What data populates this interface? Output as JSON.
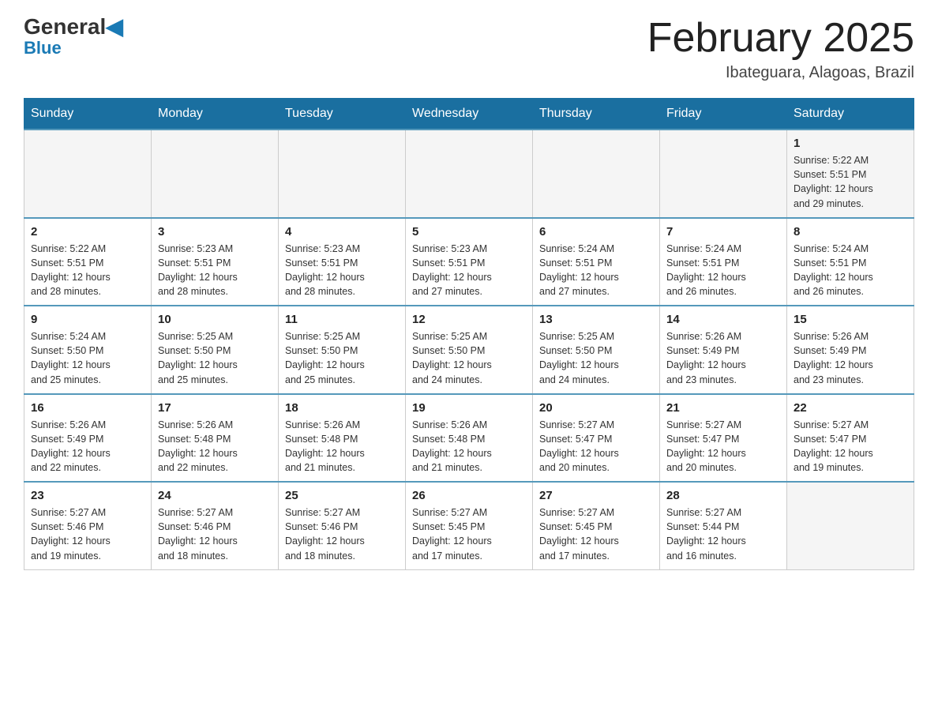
{
  "header": {
    "logo_general": "General",
    "logo_blue": "Blue",
    "month_title": "February 2025",
    "location": "Ibateguara, Alagoas, Brazil"
  },
  "weekdays": [
    "Sunday",
    "Monday",
    "Tuesday",
    "Wednesday",
    "Thursday",
    "Friday",
    "Saturday"
  ],
  "weeks": [
    {
      "days": [
        {
          "num": "",
          "info": ""
        },
        {
          "num": "",
          "info": ""
        },
        {
          "num": "",
          "info": ""
        },
        {
          "num": "",
          "info": ""
        },
        {
          "num": "",
          "info": ""
        },
        {
          "num": "",
          "info": ""
        },
        {
          "num": "1",
          "info": "Sunrise: 5:22 AM\nSunset: 5:51 PM\nDaylight: 12 hours\nand 29 minutes."
        }
      ]
    },
    {
      "days": [
        {
          "num": "2",
          "info": "Sunrise: 5:22 AM\nSunset: 5:51 PM\nDaylight: 12 hours\nand 28 minutes."
        },
        {
          "num": "3",
          "info": "Sunrise: 5:23 AM\nSunset: 5:51 PM\nDaylight: 12 hours\nand 28 minutes."
        },
        {
          "num": "4",
          "info": "Sunrise: 5:23 AM\nSunset: 5:51 PM\nDaylight: 12 hours\nand 28 minutes."
        },
        {
          "num": "5",
          "info": "Sunrise: 5:23 AM\nSunset: 5:51 PM\nDaylight: 12 hours\nand 27 minutes."
        },
        {
          "num": "6",
          "info": "Sunrise: 5:24 AM\nSunset: 5:51 PM\nDaylight: 12 hours\nand 27 minutes."
        },
        {
          "num": "7",
          "info": "Sunrise: 5:24 AM\nSunset: 5:51 PM\nDaylight: 12 hours\nand 26 minutes."
        },
        {
          "num": "8",
          "info": "Sunrise: 5:24 AM\nSunset: 5:51 PM\nDaylight: 12 hours\nand 26 minutes."
        }
      ]
    },
    {
      "days": [
        {
          "num": "9",
          "info": "Sunrise: 5:24 AM\nSunset: 5:50 PM\nDaylight: 12 hours\nand 25 minutes."
        },
        {
          "num": "10",
          "info": "Sunrise: 5:25 AM\nSunset: 5:50 PM\nDaylight: 12 hours\nand 25 minutes."
        },
        {
          "num": "11",
          "info": "Sunrise: 5:25 AM\nSunset: 5:50 PM\nDaylight: 12 hours\nand 25 minutes."
        },
        {
          "num": "12",
          "info": "Sunrise: 5:25 AM\nSunset: 5:50 PM\nDaylight: 12 hours\nand 24 minutes."
        },
        {
          "num": "13",
          "info": "Sunrise: 5:25 AM\nSunset: 5:50 PM\nDaylight: 12 hours\nand 24 minutes."
        },
        {
          "num": "14",
          "info": "Sunrise: 5:26 AM\nSunset: 5:49 PM\nDaylight: 12 hours\nand 23 minutes."
        },
        {
          "num": "15",
          "info": "Sunrise: 5:26 AM\nSunset: 5:49 PM\nDaylight: 12 hours\nand 23 minutes."
        }
      ]
    },
    {
      "days": [
        {
          "num": "16",
          "info": "Sunrise: 5:26 AM\nSunset: 5:49 PM\nDaylight: 12 hours\nand 22 minutes."
        },
        {
          "num": "17",
          "info": "Sunrise: 5:26 AM\nSunset: 5:48 PM\nDaylight: 12 hours\nand 22 minutes."
        },
        {
          "num": "18",
          "info": "Sunrise: 5:26 AM\nSunset: 5:48 PM\nDaylight: 12 hours\nand 21 minutes."
        },
        {
          "num": "19",
          "info": "Sunrise: 5:26 AM\nSunset: 5:48 PM\nDaylight: 12 hours\nand 21 minutes."
        },
        {
          "num": "20",
          "info": "Sunrise: 5:27 AM\nSunset: 5:47 PM\nDaylight: 12 hours\nand 20 minutes."
        },
        {
          "num": "21",
          "info": "Sunrise: 5:27 AM\nSunset: 5:47 PM\nDaylight: 12 hours\nand 20 minutes."
        },
        {
          "num": "22",
          "info": "Sunrise: 5:27 AM\nSunset: 5:47 PM\nDaylight: 12 hours\nand 19 minutes."
        }
      ]
    },
    {
      "days": [
        {
          "num": "23",
          "info": "Sunrise: 5:27 AM\nSunset: 5:46 PM\nDaylight: 12 hours\nand 19 minutes."
        },
        {
          "num": "24",
          "info": "Sunrise: 5:27 AM\nSunset: 5:46 PM\nDaylight: 12 hours\nand 18 minutes."
        },
        {
          "num": "25",
          "info": "Sunrise: 5:27 AM\nSunset: 5:46 PM\nDaylight: 12 hours\nand 18 minutes."
        },
        {
          "num": "26",
          "info": "Sunrise: 5:27 AM\nSunset: 5:45 PM\nDaylight: 12 hours\nand 17 minutes."
        },
        {
          "num": "27",
          "info": "Sunrise: 5:27 AM\nSunset: 5:45 PM\nDaylight: 12 hours\nand 17 minutes."
        },
        {
          "num": "28",
          "info": "Sunrise: 5:27 AM\nSunset: 5:44 PM\nDaylight: 12 hours\nand 16 minutes."
        },
        {
          "num": "",
          "info": ""
        }
      ]
    }
  ]
}
